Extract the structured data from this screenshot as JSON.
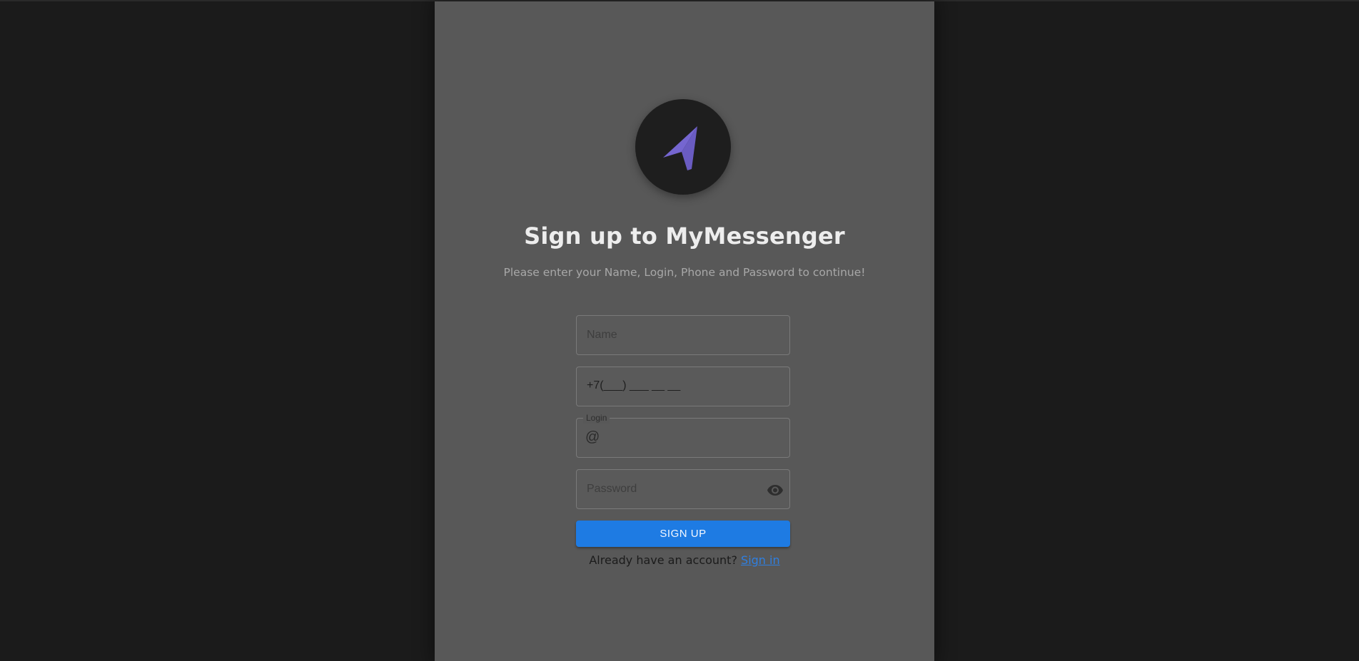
{
  "colors": {
    "background": "#1b1b1b",
    "panel": "#585858",
    "logo_bg": "#1e1e1e",
    "logo_accent": "#7566d0",
    "primary_button": "#1e7be3",
    "link": "#2f7fe0"
  },
  "logo": {
    "icon": "paper-plane-icon"
  },
  "header": {
    "title": "Sign up to MyMessenger",
    "subtitle": "Please enter your Name, Login, Phone and Password to continue!"
  },
  "form": {
    "name": {
      "placeholder": "Name",
      "value": ""
    },
    "phone": {
      "value": "+7(___) ___ __ __"
    },
    "login": {
      "label": "Login",
      "prefix": "@",
      "value": ""
    },
    "password": {
      "placeholder": "Password",
      "value": "",
      "toggle_icon": "eye-icon"
    },
    "submit_label": "SIGN UP"
  },
  "footer": {
    "prompt": "Already have an account?",
    "link_label": "Sign in"
  }
}
